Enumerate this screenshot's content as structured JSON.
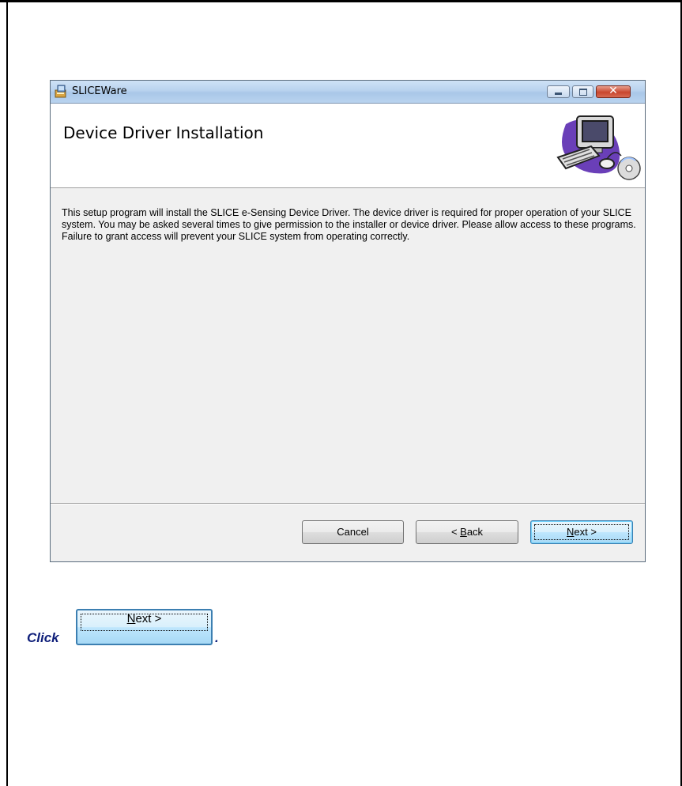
{
  "window": {
    "title": "SLICEWare",
    "close_glyph": "✕",
    "icons": [
      "installer-app-icon",
      "minimize-icon",
      "maximize-icon",
      "close-icon",
      "computer-cd-icon"
    ]
  },
  "banner": {
    "heading": "Device Driver Installation"
  },
  "content": {
    "description": "This setup program will install the SLICE e-Sensing Device Driver.  The device driver is required for proper operation of your SLICE system.  You may be asked several times to give permission to the installer or device driver.  Please allow access to these programs.  Failure to grant access will prevent your SLICE system from operating correctly."
  },
  "buttons": {
    "cancel": "Cancel",
    "back_prefix": "< ",
    "back_accel": "B",
    "back_rest": "ack",
    "next_accel": "N",
    "next_rest": "ext >"
  },
  "instruction": {
    "prefix": "Click",
    "button_accel": "N",
    "button_rest": "ext >",
    "suffix": "."
  },
  "colors": {
    "instruction_text": "#0f1f7a",
    "titlebar": "#b8d2ee",
    "close_button": "#c9462e"
  }
}
